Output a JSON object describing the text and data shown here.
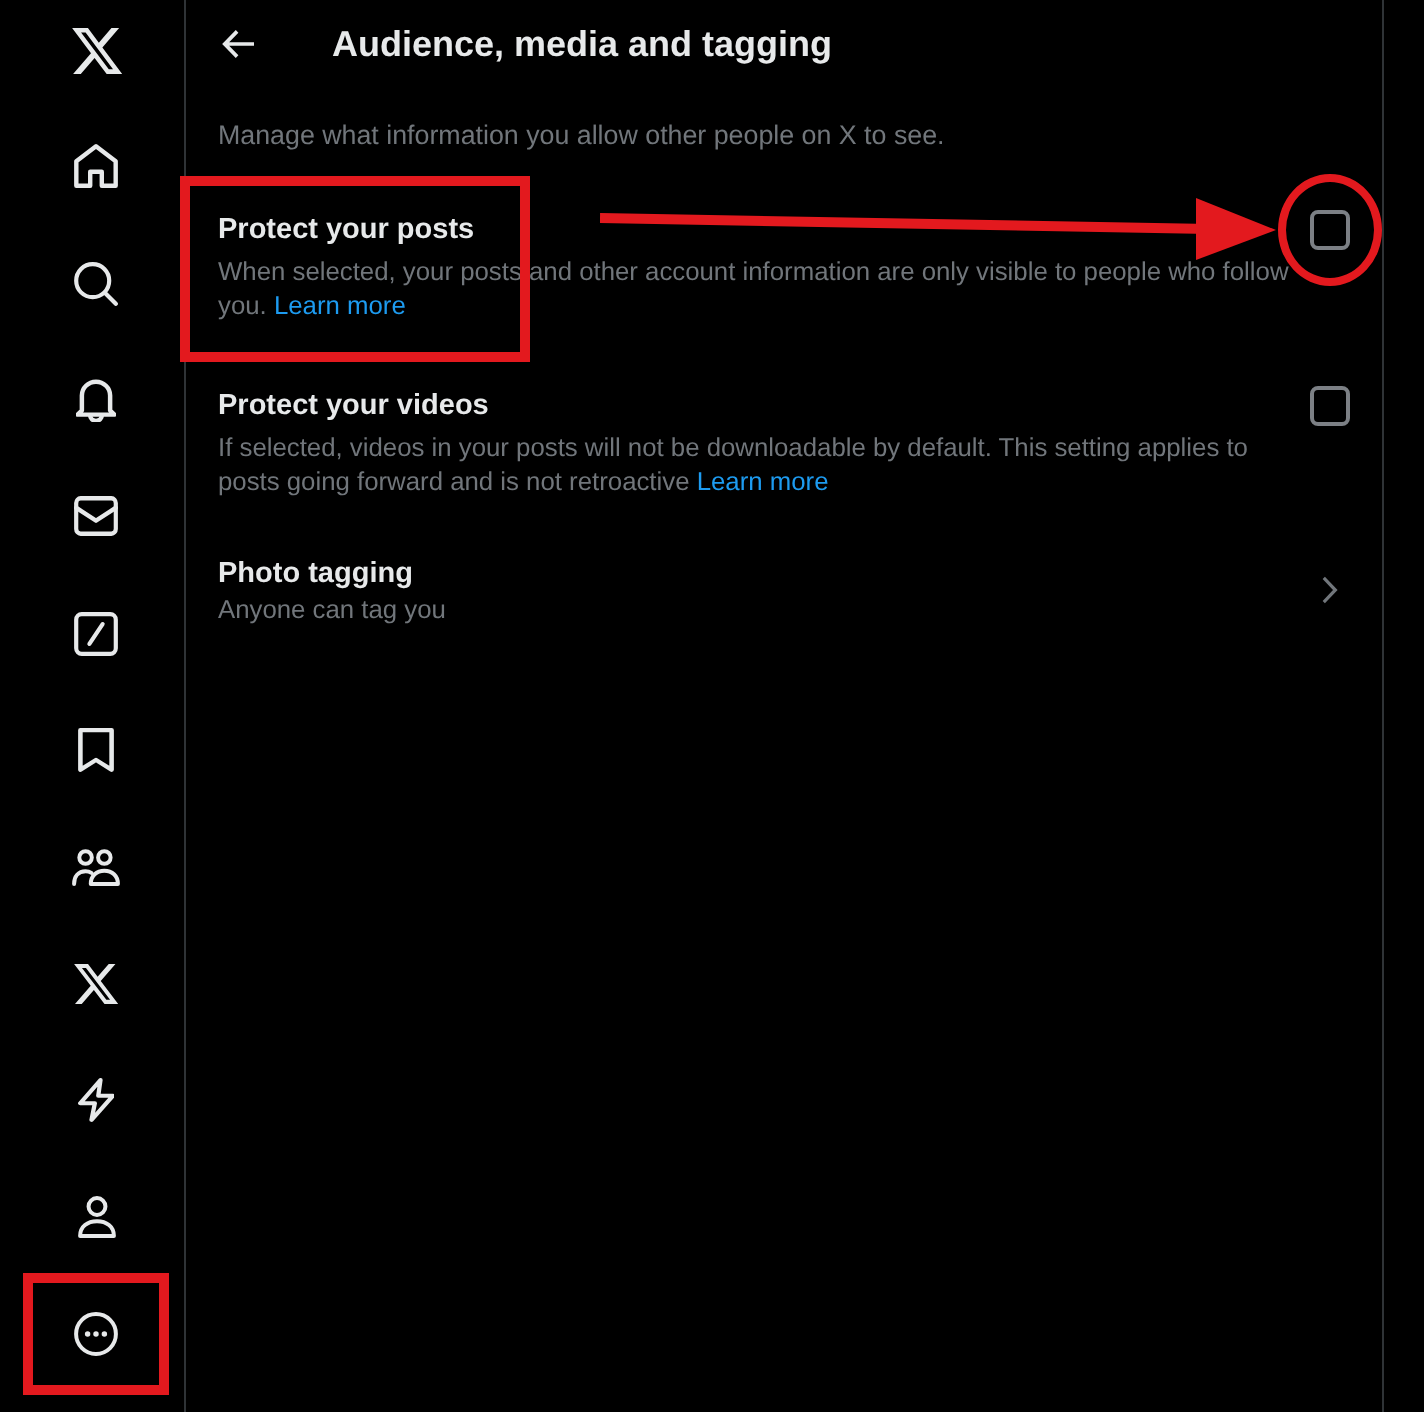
{
  "sidebar": {
    "items": [
      {
        "kind": "logo",
        "highlighted": false
      },
      {
        "kind": "home",
        "highlighted": false
      },
      {
        "kind": "search",
        "highlighted": false
      },
      {
        "kind": "bell",
        "highlighted": false
      },
      {
        "kind": "envelope",
        "highlighted": false
      },
      {
        "kind": "slash_square",
        "highlighted": false
      },
      {
        "kind": "bookmark",
        "highlighted": false
      },
      {
        "kind": "people",
        "highlighted": false
      },
      {
        "kind": "x_mark",
        "highlighted": false
      },
      {
        "kind": "lightning",
        "highlighted": false
      },
      {
        "kind": "person",
        "highlighted": false
      },
      {
        "kind": "more",
        "highlighted": true
      }
    ]
  },
  "header": {
    "title": "Audience, media and tagging"
  },
  "intro": "Manage what information you allow other people on X to see.",
  "settings": [
    {
      "kind": "checkbox",
      "title": "Protect your posts",
      "description": "When selected, your posts and other account information are only visible to people who follow you.",
      "link": "Learn more",
      "checked": false,
      "highlighted": true,
      "arrow_to_control": true,
      "control_circled": true
    },
    {
      "kind": "checkbox",
      "title": "Protect your videos",
      "description": "If selected, videos in your posts will not be downloadable by default. This setting applies to posts going forward and is not retroactive",
      "link": "Learn more",
      "checked": false,
      "highlighted": false,
      "arrow_to_control": false,
      "control_circled": false
    },
    {
      "kind": "link",
      "title": "Photo tagging",
      "value": "Anyone can tag you",
      "highlighted": false,
      "arrow_to_control": false,
      "control_circled": false
    }
  ]
}
